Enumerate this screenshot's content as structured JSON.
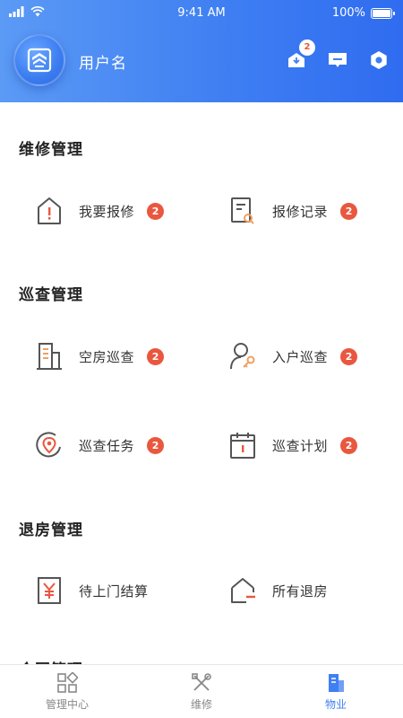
{
  "status_bar": {
    "time": "9:41 AM",
    "battery": "100%"
  },
  "header": {
    "username": "用户名",
    "notification_count": "2"
  },
  "sections": [
    {
      "title": "维修管理",
      "items": [
        {
          "label": "我要报修",
          "badge": "2",
          "icon": "house-alert-icon"
        },
        {
          "label": "报修记录",
          "badge": "2",
          "icon": "document-search-icon"
        }
      ]
    },
    {
      "title": "巡查管理",
      "items": [
        {
          "label": "空房巡查",
          "badge": "2",
          "icon": "building-icon"
        },
        {
          "label": "入户巡查",
          "badge": "2",
          "icon": "person-key-icon"
        },
        {
          "label": "巡查任务",
          "badge": "2",
          "icon": "location-pin-icon"
        },
        {
          "label": "巡查计划",
          "badge": "2",
          "icon": "calendar-icon"
        }
      ]
    },
    {
      "title": "退房管理",
      "items": [
        {
          "label": "待上门结算",
          "icon": "yuan-receipt-icon"
        },
        {
          "label": "所有退房",
          "icon": "house-minus-icon"
        }
      ]
    },
    {
      "title": "合同管理"
    }
  ],
  "tabbar": {
    "tabs": [
      {
        "label": "管理中心",
        "icon": "grid-icon"
      },
      {
        "label": "维修",
        "icon": "tools-icon"
      },
      {
        "label": "物业",
        "icon": "property-icon",
        "active": true
      }
    ]
  },
  "colors": {
    "primary": "#3f7ff2",
    "accent": "#e9573f",
    "text": "#333333"
  }
}
